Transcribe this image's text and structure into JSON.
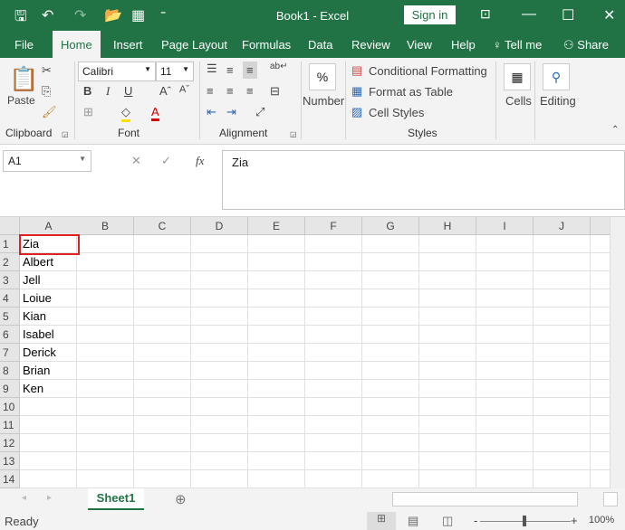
{
  "title": "Book1  -  Excel",
  "signin": "Sign in",
  "tabs": [
    "File",
    "Home",
    "Insert",
    "Page Layout",
    "Formulas",
    "Data",
    "Review",
    "View",
    "Help",
    "Tell me",
    "Share"
  ],
  "ribbon": {
    "paste": "Paste",
    "font_name": "Calibri",
    "font_size": "11",
    "bold": "B",
    "italic": "I",
    "underline": "U",
    "number": "Number",
    "percent": "%",
    "cond_format": "Conditional Formatting",
    "format_table": "Format as Table",
    "cell_styles": "Cell Styles",
    "cells": "Cells",
    "editing": "Editing",
    "groups": {
      "clipboard": "Clipboard",
      "font": "Font",
      "alignment": "Alignment",
      "styles": "Styles"
    }
  },
  "namebox": "A1",
  "fx": "fx",
  "formula": "Zia",
  "columns": [
    "A",
    "B",
    "C",
    "D",
    "E",
    "F",
    "G",
    "H",
    "I",
    "J"
  ],
  "rows": [
    "1",
    "2",
    "3",
    "4",
    "5",
    "6",
    "7",
    "8",
    "9",
    "10",
    "11",
    "12",
    "13",
    "14"
  ],
  "cells_a": [
    "Zia",
    "Albert",
    "Jell",
    "Loiue",
    "Kian",
    "Isabel",
    "Derick",
    "Brian",
    "Ken"
  ],
  "sheet": "Sheet1",
  "status": "Ready",
  "zoom": "100%",
  "colors": {
    "accent": "#217346",
    "selection": "#e02020"
  }
}
